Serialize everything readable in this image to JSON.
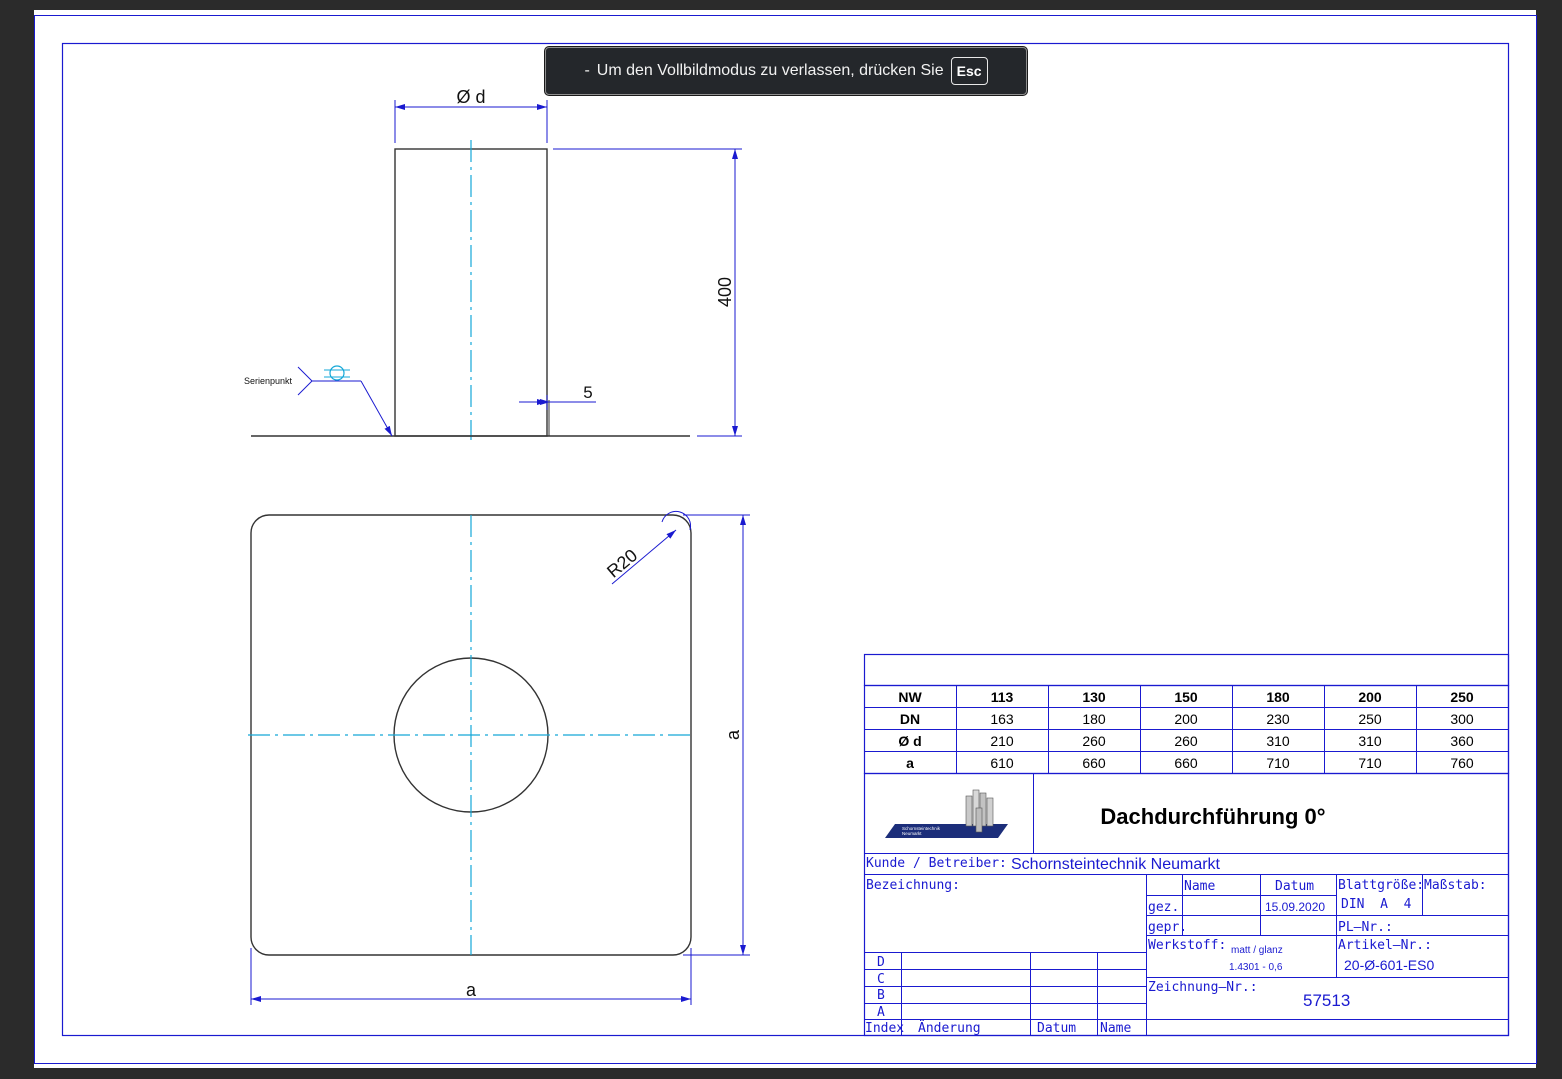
{
  "notification": {
    "prefix": "-",
    "message": "Um den Vollbildmodus zu verlassen, drücken Sie",
    "key": "Esc"
  },
  "dimensions": {
    "diameter": "Ø d",
    "height": "400",
    "offset": "5",
    "radius": "R20",
    "side_vertical": "a",
    "side_horizontal": "a",
    "weld_label": "Serienpunkt"
  },
  "spec_table": {
    "headers": [
      "NW",
      "113",
      "130",
      "150",
      "180",
      "200",
      "250"
    ],
    "rows": [
      {
        "label": "DN",
        "values": [
          "163",
          "180",
          "200",
          "230",
          "250",
          "300"
        ]
      },
      {
        "label": "Ø d",
        "values": [
          "210",
          "260",
          "260",
          "310",
          "310",
          "360"
        ]
      },
      {
        "label": "a",
        "values": [
          "610",
          "660",
          "660",
          "710",
          "710",
          "760"
        ]
      }
    ]
  },
  "title_block": {
    "logo_text_1": "Schornsteintechnik",
    "logo_text_2": "Neumarkt",
    "title": "Dachdurchführung 0°",
    "customer_label": "Kunde  /  Betreiber:",
    "customer_value": "Schornsteintechnik Neumarkt",
    "designation_label": "Bezeichnung:",
    "name_header": "Name",
    "date_header": "Datum",
    "drawn_label": "gez.",
    "drawn_date": "15.09.2020",
    "checked_label": "gepr.",
    "sheet_size_label": "Blattgröße:",
    "sheet_size_value": "DIN  A  4",
    "scale_label": "Maßstab:",
    "pl_label": "PL—Nr.:",
    "material_label": "Werkstoff:",
    "material_line1": "matt / glanz",
    "material_line2": "1.4301 - 0,6",
    "article_label": "Artikel—Nr.:",
    "article_value": "20-Ø-601-ES0",
    "drawing_no_label": "Zeichnung—Nr.:",
    "drawing_no_value": "57513",
    "revisions": [
      "D",
      "C",
      "B",
      "A"
    ],
    "rev_index_label": "Index",
    "rev_change_label": "Änderung",
    "rev_date_label": "Datum",
    "rev_name_label": "Name"
  },
  "colors": {
    "frame": "#1a1ad0",
    "centerline": "#14a8d8",
    "outline": "#333333",
    "toast_bg": "#24272b"
  }
}
